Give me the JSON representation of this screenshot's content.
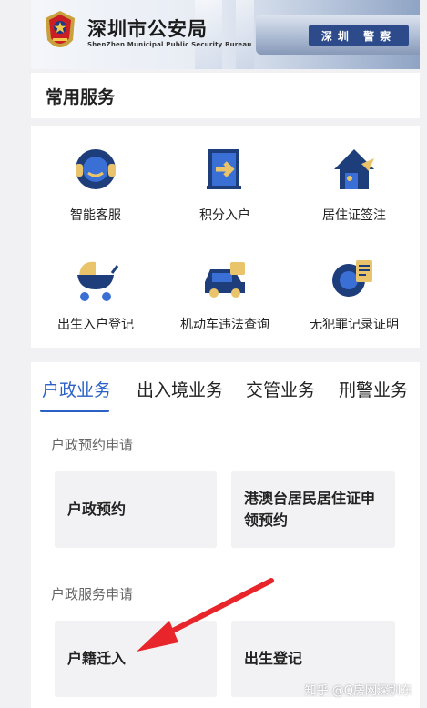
{
  "header": {
    "title": "深圳市公安局",
    "subtitle": "ShenZhen Municipal Public Security Bureau",
    "car_label": "深圳 警察"
  },
  "common_services": {
    "title": "常用服务",
    "items": [
      {
        "label": "智能客服",
        "icon": "customer-service-icon"
      },
      {
        "label": "积分入户",
        "icon": "points-household-icon"
      },
      {
        "label": "居住证签注",
        "icon": "residence-permit-icon"
      },
      {
        "label": "出生入户登记",
        "icon": "birth-registration-icon"
      },
      {
        "label": "机动车违法查询",
        "icon": "vehicle-violation-icon"
      },
      {
        "label": "无犯罪记录证明",
        "icon": "no-criminal-record-icon"
      }
    ]
  },
  "tabs": [
    {
      "label": "户政业务",
      "active": true
    },
    {
      "label": "出入境业务",
      "active": false
    },
    {
      "label": "交管业务",
      "active": false
    },
    {
      "label": "刑警业务",
      "active": false
    }
  ],
  "groups": [
    {
      "title": "户政预约申请",
      "cards": [
        "户政预约",
        "港澳台居民居住证申领预约"
      ]
    },
    {
      "title": "户政服务申请",
      "cards": [
        "户籍迁入",
        "出生登记"
      ]
    }
  ],
  "watermark": "知乎 @Q房网深圳东",
  "colors": {
    "accent": "#2b61c7",
    "icon_navy": "#1e3d7b",
    "icon_gold": "#e9c46a",
    "icon_blue": "#3a6fd6",
    "arrow_red": "#e8252a"
  }
}
